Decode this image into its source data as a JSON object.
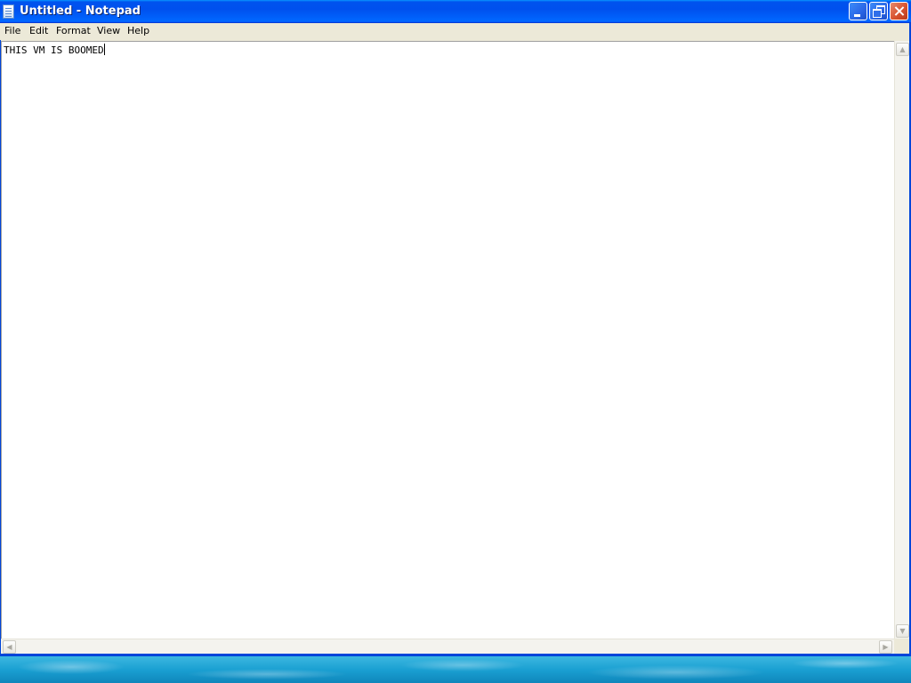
{
  "window": {
    "title": "Untitled - Notepad",
    "app_icon": "notepad-icon",
    "controls": [
      "minimize-icon",
      "restore-icon",
      "close-icon"
    ]
  },
  "menubar": {
    "items": [
      {
        "label": "File"
      },
      {
        "label": "Edit"
      },
      {
        "label": "Format"
      },
      {
        "label": "View"
      },
      {
        "label": "Help"
      }
    ]
  },
  "editor": {
    "content": "THIS VM IS BOOMED"
  },
  "scrollbars": {
    "up_arrow": "▲",
    "down_arrow": "▼",
    "left_arrow": "◀",
    "right_arrow": "▶"
  },
  "colors": {
    "titlebar": "#0053ee",
    "menubar": "#ece9d8",
    "editor_bg": "#ffffff",
    "desktop": "#1aa0d2"
  }
}
